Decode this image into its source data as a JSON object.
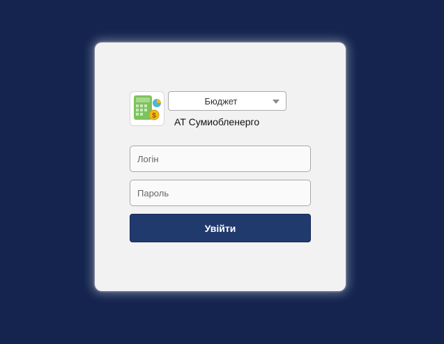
{
  "login_card": {
    "module_select": {
      "selected": "Бюджет"
    },
    "company_name": "АТ Сумиобленерго",
    "login_field": {
      "placeholder": "Логін",
      "value": ""
    },
    "password_field": {
      "placeholder": "Пароль",
      "value": ""
    },
    "submit_label": "Увійти"
  },
  "icons": {
    "logo": "calculator-budget-icon",
    "dropdown": "chevron-down-icon"
  },
  "colors": {
    "page_background": "#14244f",
    "card_background": "#f2f2f2",
    "button_background": "#213a6e",
    "button_text": "#ffffff",
    "logo_green": "#7dc35d",
    "logo_coin": "#f2b81b"
  }
}
